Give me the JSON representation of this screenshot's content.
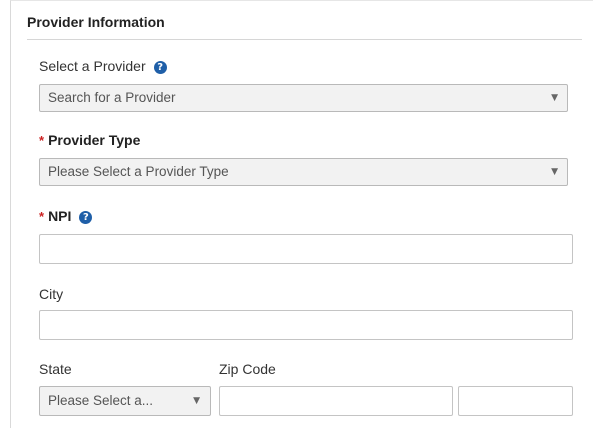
{
  "section": {
    "title": "Provider Information"
  },
  "provider": {
    "label": "Select a Provider",
    "placeholder": "Search for a Provider"
  },
  "provider_type": {
    "required_mark": "*",
    "label": "Provider Type",
    "placeholder": "Please Select a Provider Type"
  },
  "npi": {
    "required_mark": "*",
    "label": "NPI",
    "value": ""
  },
  "city": {
    "label": "City",
    "value": ""
  },
  "state": {
    "label": "State",
    "placeholder": "Please Select a..."
  },
  "zip": {
    "label": "Zip Code",
    "value": "",
    "ext_value": ""
  },
  "icons": {
    "help": "question-circle-icon",
    "dropdown": "caret-down-icon"
  },
  "colors": {
    "help_icon": "#1f5fa8",
    "required": "#cc2222",
    "select_bg": "#f2f2f2",
    "border": "#c4c4c4"
  }
}
